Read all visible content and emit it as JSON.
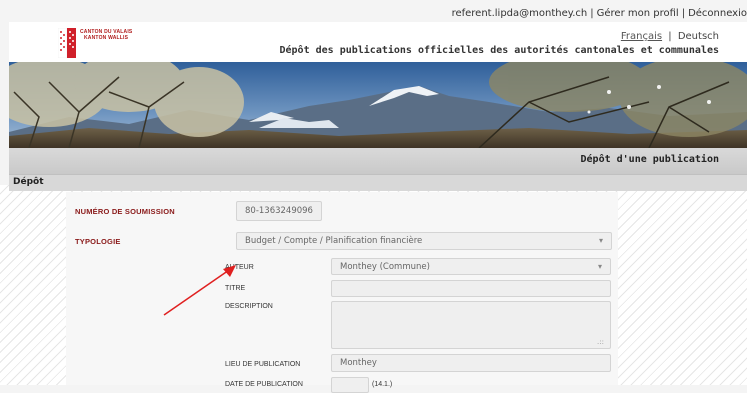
{
  "top_links": {
    "user": "referent.lipda@monthey.ch",
    "profile": "Gérer mon profil",
    "logout": "Déconnexio"
  },
  "header": {
    "logo_line1": "CANTON DU VALAIS",
    "logo_line2": "KANTON WALLIS",
    "lang_fr": "Français",
    "lang_de": "Deutsch",
    "subtitle": "Dépôt des publications officielles des autorités cantonales et communales"
  },
  "section_title": "Dépôt d'une publication",
  "breadcrumb": "Dépôt",
  "form": {
    "numero_label": "NUMÉRO DE SOUMISSION",
    "numero_value": "80-1363249096",
    "typologie_label": "TYPOLOGIE",
    "typologie_value": "Budget / Compte / Planification financière",
    "auteur_label": "AUTEUR",
    "auteur_value": "Monthey (Commune)",
    "titre_label": "TITRE",
    "titre_value": "",
    "description_label": "DESCRIPTION",
    "description_value": "",
    "lieu_label": "LIEU DE PUBLICATION",
    "lieu_value": "Monthey",
    "date_label": "DATE DE PUBLICATION",
    "date_hint": "(14.1.)"
  },
  "colors": {
    "label_red": "#8a1a1a",
    "annotation_arrow": "#e02020"
  }
}
